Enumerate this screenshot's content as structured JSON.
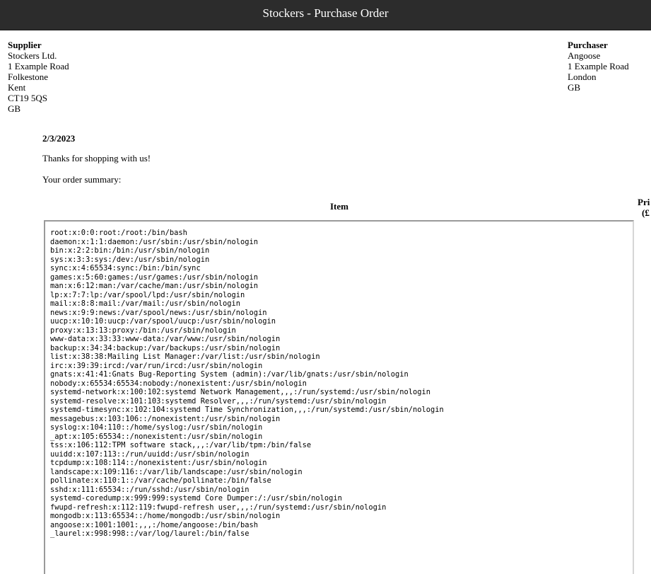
{
  "header": {
    "title": "Stockers - Purchase Order"
  },
  "supplier": {
    "heading": "Supplier",
    "lines": [
      "Stockers Ltd.",
      "1 Example Road",
      "Folkestone",
      "Kent",
      "CT19 5QS",
      "GB"
    ]
  },
  "purchaser": {
    "heading": "Purchaser",
    "lines": [
      "Angoose",
      "1 Example Road",
      "London",
      "GB"
    ]
  },
  "order": {
    "date": "2/3/2023",
    "thanks": "Thanks for shopping with us!",
    "summary_label": "Your order summary:"
  },
  "table": {
    "item_header": "Item",
    "price_header_line1": "Pri",
    "price_header_line2": "(£",
    "item_content_lines": [
      "root:x:0:0:root:/root:/bin/bash",
      "daemon:x:1:1:daemon:/usr/sbin:/usr/sbin/nologin",
      "bin:x:2:2:bin:/bin:/usr/sbin/nologin",
      "sys:x:3:3:sys:/dev:/usr/sbin/nologin",
      "sync:x:4:65534:sync:/bin:/bin/sync",
      "games:x:5:60:games:/usr/games:/usr/sbin/nologin",
      "man:x:6:12:man:/var/cache/man:/usr/sbin/nologin",
      "lp:x:7:7:lp:/var/spool/lpd:/usr/sbin/nologin",
      "mail:x:8:8:mail:/var/mail:/usr/sbin/nologin",
      "news:x:9:9:news:/var/spool/news:/usr/sbin/nologin",
      "uucp:x:10:10:uucp:/var/spool/uucp:/usr/sbin/nologin",
      "proxy:x:13:13:proxy:/bin:/usr/sbin/nologin",
      "www-data:x:33:33:www-data:/var/www:/usr/sbin/nologin",
      "backup:x:34:34:backup:/var/backups:/usr/sbin/nologin",
      "list:x:38:38:Mailing List Manager:/var/list:/usr/sbin/nologin",
      "irc:x:39:39:ircd:/var/run/ircd:/usr/sbin/nologin",
      "gnats:x:41:41:Gnats Bug-Reporting System (admin):/var/lib/gnats:/usr/sbin/nologin",
      "nobody:x:65534:65534:nobody:/nonexistent:/usr/sbin/nologin",
      "systemd-network:x:100:102:systemd Network Management,,,:/run/systemd:/usr/sbin/nologin",
      "systemd-resolve:x:101:103:systemd Resolver,,,:/run/systemd:/usr/sbin/nologin",
      "systemd-timesync:x:102:104:systemd Time Synchronization,,,:/run/systemd:/usr/sbin/nologin",
      "messagebus:x:103:106::/nonexistent:/usr/sbin/nologin",
      "syslog:x:104:110::/home/syslog:/usr/sbin/nologin",
      "_apt:x:105:65534::/nonexistent:/usr/sbin/nologin",
      "tss:x:106:112:TPM software stack,,,:/var/lib/tpm:/bin/false",
      "uuidd:x:107:113::/run/uuidd:/usr/sbin/nologin",
      "tcpdump:x:108:114::/nonexistent:/usr/sbin/nologin",
      "landscape:x:109:116::/var/lib/landscape:/usr/sbin/nologin",
      "pollinate:x:110:1::/var/cache/pollinate:/bin/false",
      "sshd:x:111:65534::/run/sshd:/usr/sbin/nologin",
      "systemd-coredump:x:999:999:systemd Core Dumper:/:/usr/sbin/nologin",
      "fwupd-refresh:x:112:119:fwupd-refresh user,,,:/run/systemd:/usr/sbin/nologin",
      "mongodb:x:113:65534::/home/mongodb:/usr/sbin/nologin",
      "angoose:x:1001:1001:,,,:/home/angoose:/bin/bash",
      "_laurel:x:998:998::/var/log/laurel:/bin/false"
    ]
  }
}
